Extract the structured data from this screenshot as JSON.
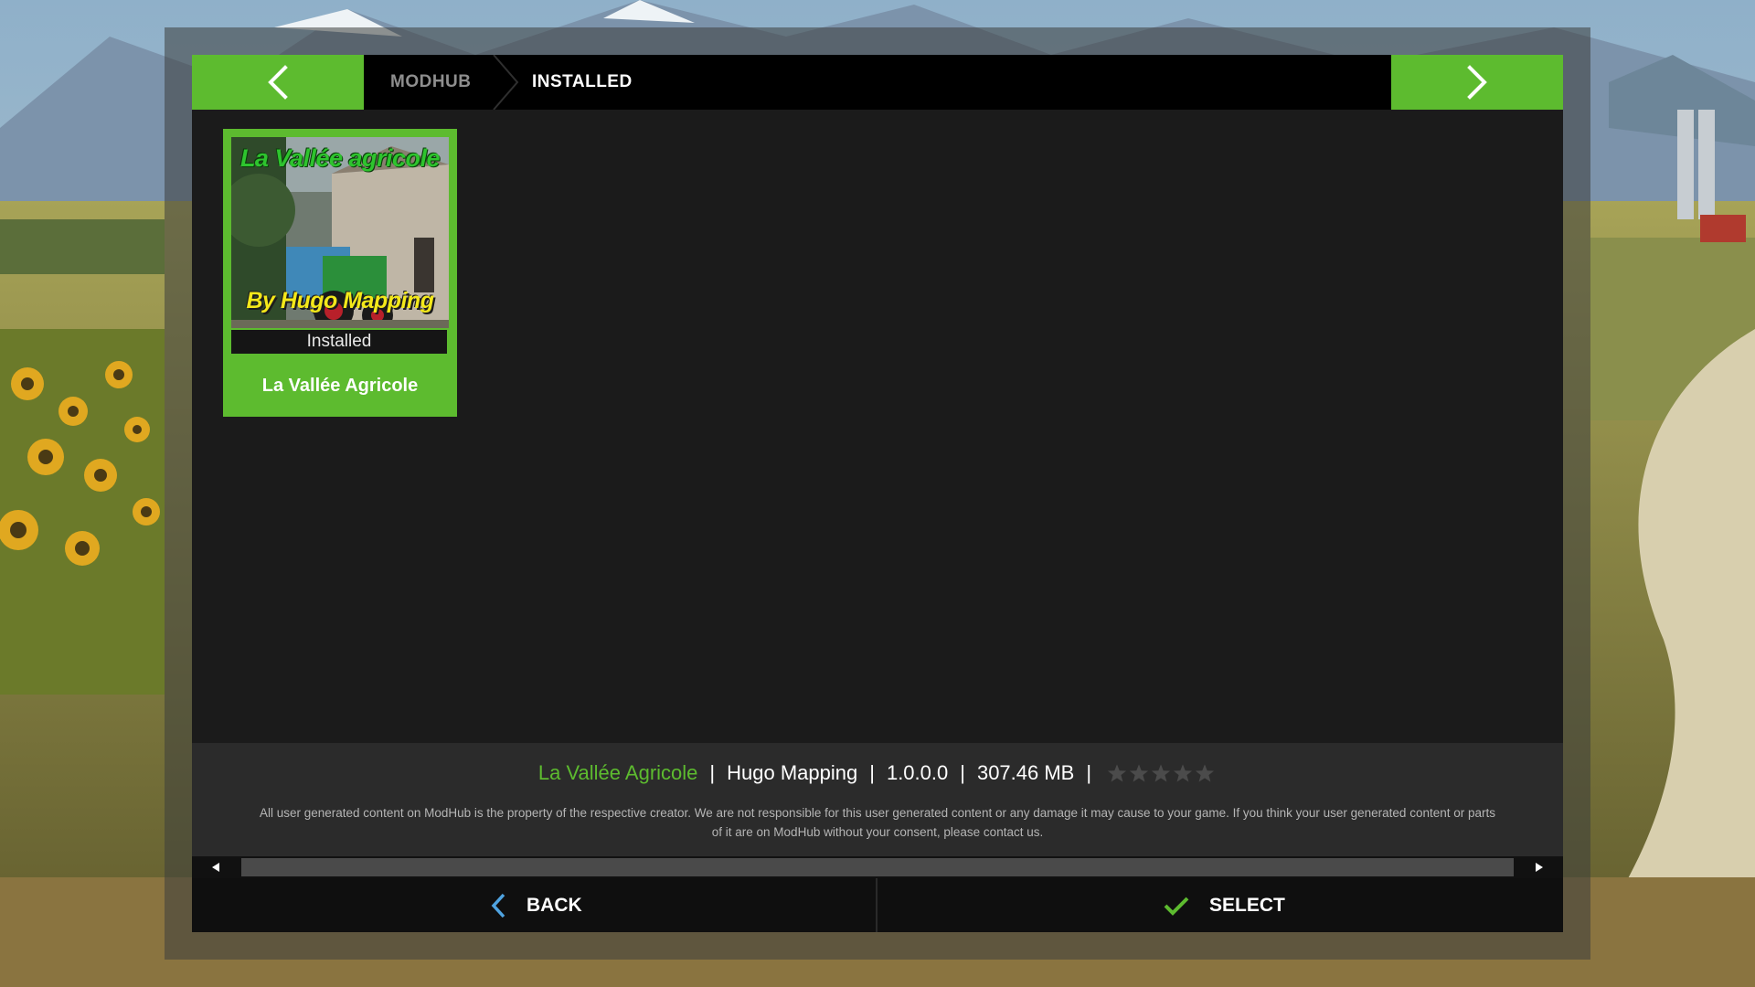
{
  "colors": {
    "accent": "#5dbb2f",
    "panel": "#1b1b1b",
    "header": "#000000",
    "back_icon": "#4fa3e0"
  },
  "header": {
    "prev_icon": "chevron-left-icon",
    "next_icon": "chevron-right-icon",
    "breadcrumb": [
      "MODHUB",
      "INSTALLED"
    ]
  },
  "mods": [
    {
      "thumbnail_title": "La Vallée agricole",
      "thumbnail_author": "By Hugo Mapping",
      "status": "Installed",
      "name": "La Vallée Agricole"
    }
  ],
  "details": {
    "name": "La Vallée Agricole",
    "author": "Hugo Mapping",
    "version": "1.0.0.0",
    "size": "307.46 MB",
    "rating_stars_filled": 0,
    "rating_stars_total": 5,
    "disclaimer": "All user generated content on ModHub is the property of the respective creator. We are not responsible for this user generated content or any damage it may cause to your game. If you think your user generated content or parts of it are on ModHub without your consent, please contact us."
  },
  "footer": {
    "back_label": "BACK",
    "select_label": "SELECT"
  }
}
